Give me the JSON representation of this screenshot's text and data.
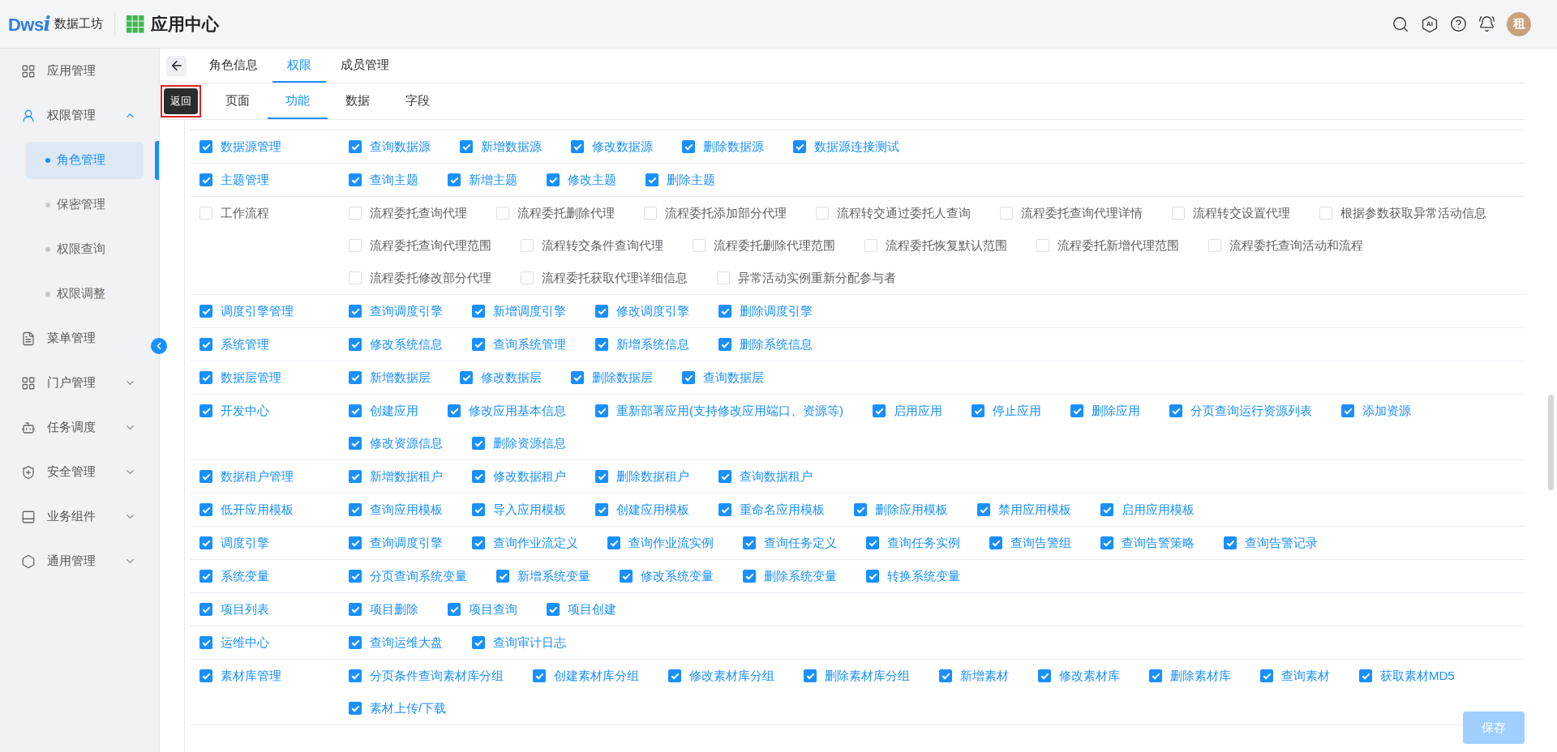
{
  "header": {
    "logo_mark": "Dws",
    "logo_accent": "i",
    "logo_text": "数据工坊",
    "app_title": "应用中心",
    "ai_label": "AI",
    "avatar": "租"
  },
  "sidebar": {
    "items": [
      {
        "label": "应用管理",
        "selected": false
      },
      {
        "label": "权限管理",
        "selected": false,
        "expanded": true,
        "children": [
          {
            "label": "角色管理",
            "selected": true
          },
          {
            "label": "保密管理",
            "selected": false
          },
          {
            "label": "权限查询",
            "selected": false
          },
          {
            "label": "权限调整",
            "selected": false
          }
        ]
      },
      {
        "label": "菜单管理",
        "selected": false
      },
      {
        "label": "门户管理",
        "selected": false,
        "expanded": false
      },
      {
        "label": "任务调度",
        "selected": false,
        "expanded": false
      },
      {
        "label": "安全管理",
        "selected": false,
        "expanded": false
      },
      {
        "label": "业务组件",
        "selected": false,
        "expanded": false
      },
      {
        "label": "通用管理",
        "selected": false,
        "expanded": false
      }
    ]
  },
  "tabs": [
    {
      "label": "角色信息",
      "selected": false
    },
    {
      "label": "权限",
      "selected": true
    },
    {
      "label": "成员管理",
      "selected": false
    }
  ],
  "back_button": "返回",
  "subtabs": [
    {
      "label": "页面",
      "selected": false
    },
    {
      "label": "功能",
      "selected": true
    },
    {
      "label": "数据",
      "selected": false
    },
    {
      "label": "字段",
      "selected": false
    }
  ],
  "permissions": [
    {
      "label": "数据源管理",
      "checked": true,
      "items": [
        {
          "label": "查询数据源",
          "checked": true
        },
        {
          "label": "新增数据源",
          "checked": true
        },
        {
          "label": "修改数据源",
          "checked": true
        },
        {
          "label": "删除数据源",
          "checked": true
        },
        {
          "label": "数据源连接测试",
          "checked": true
        }
      ]
    },
    {
      "label": "主题管理",
      "checked": true,
      "items": [
        {
          "label": "查询主题",
          "checked": true
        },
        {
          "label": "新增主题",
          "checked": true
        },
        {
          "label": "修改主题",
          "checked": true
        },
        {
          "label": "删除主题",
          "checked": true
        }
      ]
    },
    {
      "label": "工作流程",
      "checked": false,
      "items": [
        {
          "label": "流程委托查询代理",
          "checked": false
        },
        {
          "label": "流程委托删除代理",
          "checked": false
        },
        {
          "label": "流程委托添加部分代理",
          "checked": false
        },
        {
          "label": "流程转交通过委托人查询",
          "checked": false
        },
        {
          "label": "流程委托查询代理详情",
          "checked": false
        },
        {
          "label": "流程转交设置代理",
          "checked": false
        },
        {
          "label": "根据参数获取异常活动信息",
          "checked": false
        },
        {
          "label": "流程委托查询代理范围",
          "checked": false
        },
        {
          "label": "流程转交条件查询代理",
          "checked": false
        },
        {
          "label": "流程委托删除代理范围",
          "checked": false
        },
        {
          "label": "流程委托恢复默认范围",
          "checked": false
        },
        {
          "label": "流程委托新增代理范围",
          "checked": false
        },
        {
          "label": "流程委托查询活动和流程",
          "checked": false
        },
        {
          "label": "流程委托修改部分代理",
          "checked": false
        },
        {
          "label": "流程委托获取代理详细信息",
          "checked": false
        },
        {
          "label": "异常活动实例重新分配参与者",
          "checked": false
        }
      ]
    },
    {
      "label": "调度引擎管理",
      "checked": true,
      "items": [
        {
          "label": "查询调度引擎",
          "checked": true
        },
        {
          "label": "新增调度引擎",
          "checked": true
        },
        {
          "label": "修改调度引擎",
          "checked": true
        },
        {
          "label": "删除调度引擎",
          "checked": true
        }
      ]
    },
    {
      "label": "系统管理",
      "checked": true,
      "items": [
        {
          "label": "修改系统信息",
          "checked": true
        },
        {
          "label": "查询系统管理",
          "checked": true
        },
        {
          "label": "新增系统信息",
          "checked": true
        },
        {
          "label": "删除系统信息",
          "checked": true
        }
      ]
    },
    {
      "label": "数据层管理",
      "checked": true,
      "items": [
        {
          "label": "新增数据层",
          "checked": true
        },
        {
          "label": "修改数据层",
          "checked": true
        },
        {
          "label": "删除数据层",
          "checked": true
        },
        {
          "label": "查询数据层",
          "checked": true
        }
      ]
    },
    {
      "label": "开发中心",
      "checked": true,
      "items": [
        {
          "label": "创建应用",
          "checked": true
        },
        {
          "label": "修改应用基本信息",
          "checked": true
        },
        {
          "label": "重新部署应用(支持修改应用端口、资源等)",
          "checked": true
        },
        {
          "label": "启用应用",
          "checked": true
        },
        {
          "label": "停止应用",
          "checked": true
        },
        {
          "label": "删除应用",
          "checked": true
        },
        {
          "label": "分页查询运行资源列表",
          "checked": true
        },
        {
          "label": "添加资源",
          "checked": true
        },
        {
          "label": "修改资源信息",
          "checked": true
        },
        {
          "label": "删除资源信息",
          "checked": true
        }
      ]
    },
    {
      "label": "数据租户管理",
      "checked": true,
      "items": [
        {
          "label": "新增数据租户",
          "checked": true
        },
        {
          "label": "修改数据租户",
          "checked": true
        },
        {
          "label": "删除数据租户",
          "checked": true
        },
        {
          "label": "查询数据租户",
          "checked": true
        }
      ]
    },
    {
      "label": "低开应用模板",
      "checked": true,
      "items": [
        {
          "label": "查询应用模板",
          "checked": true
        },
        {
          "label": "导入应用模板",
          "checked": true
        },
        {
          "label": "创建应用模板",
          "checked": true
        },
        {
          "label": "重命名应用模板",
          "checked": true
        },
        {
          "label": "删除应用模板",
          "checked": true
        },
        {
          "label": "禁用应用模板",
          "checked": true
        },
        {
          "label": "启用应用模板",
          "checked": true
        }
      ]
    },
    {
      "label": "调度引擎",
      "checked": true,
      "items": [
        {
          "label": "查询调度引擎",
          "checked": true
        },
        {
          "label": "查询作业流定义",
          "checked": true
        },
        {
          "label": "查询作业流实例",
          "checked": true
        },
        {
          "label": "查询任务定义",
          "checked": true
        },
        {
          "label": "查询任务实例",
          "checked": true
        },
        {
          "label": "查询告警组",
          "checked": true
        },
        {
          "label": "查询告警策略",
          "checked": true
        },
        {
          "label": "查询告警记录",
          "checked": true
        }
      ]
    },
    {
      "label": "系统变量",
      "checked": true,
      "items": [
        {
          "label": "分页查询系统变量",
          "checked": true
        },
        {
          "label": "新增系统变量",
          "checked": true
        },
        {
          "label": "修改系统变量",
          "checked": true
        },
        {
          "label": "删除系统变量",
          "checked": true
        },
        {
          "label": "转换系统变量",
          "checked": true
        }
      ]
    },
    {
      "label": "项目列表",
      "checked": true,
      "items": [
        {
          "label": "项目删除",
          "checked": true
        },
        {
          "label": "项目查询",
          "checked": true
        },
        {
          "label": "项目创建",
          "checked": true
        }
      ]
    },
    {
      "label": "运维中心",
      "checked": true,
      "items": [
        {
          "label": "查询运维大盘",
          "checked": true
        },
        {
          "label": "查询审计日志",
          "checked": true
        }
      ]
    },
    {
      "label": "素材库管理",
      "checked": true,
      "items": [
        {
          "label": "分页条件查询素材库分组",
          "checked": true
        },
        {
          "label": "创建素材库分组",
          "checked": true
        },
        {
          "label": "修改素材库分组",
          "checked": true
        },
        {
          "label": "删除素材库分组",
          "checked": true
        },
        {
          "label": "新增素材",
          "checked": true
        },
        {
          "label": "修改素材库",
          "checked": true
        },
        {
          "label": "删除素材库",
          "checked": true
        },
        {
          "label": "查询素材",
          "checked": true
        },
        {
          "label": "获取素材MD5",
          "checked": true
        },
        {
          "label": "素材上传/下载",
          "checked": true
        }
      ]
    }
  ],
  "save_button": {
    "label": "保存",
    "disabled": true
  }
}
